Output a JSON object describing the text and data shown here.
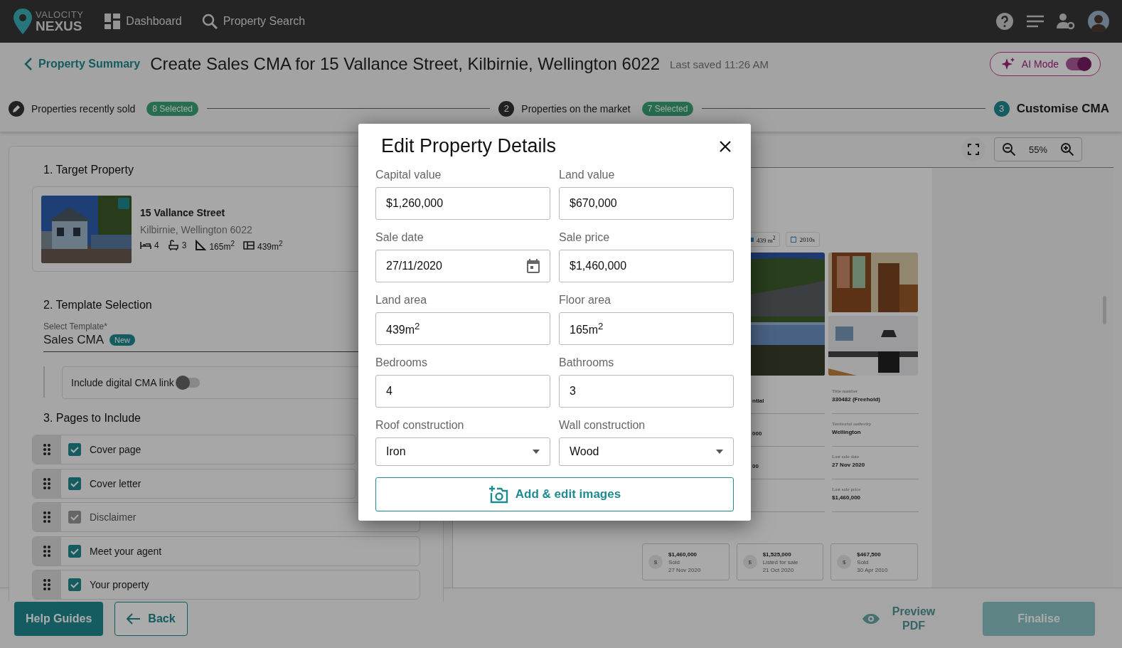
{
  "topbar": {
    "brand_top": "VALOCITY",
    "brand_bottom": "NEXUS",
    "nav": [
      {
        "kind": "dashboard",
        "label": "Dashboard"
      },
      {
        "kind": "search",
        "label": "Property Search"
      }
    ]
  },
  "header": {
    "back_link": "Property Summary",
    "title": "Create Sales CMA for 15 Vallance Street, Kilbirnie, Wellington 6022",
    "last_saved": "Last saved 11:26 AM",
    "ai_mode": {
      "label": "AI Mode",
      "on": true
    }
  },
  "stepper": [
    {
      "kind": "edit",
      "label": "Properties recently sold",
      "badge": "8 Selected",
      "selected": false
    },
    {
      "kind": "number",
      "number": "2",
      "label": "Properties on the market",
      "badge": "7 Selected",
      "selected": false
    },
    {
      "kind": "number",
      "number": "3",
      "label": "Customise CMA",
      "selected": true
    }
  ],
  "target_property": {
    "heading": "1. Target Property",
    "name": "15 Vallance Street",
    "address": "Kilbirnie, Wellington 6022",
    "stats": [
      {
        "kind": "bed",
        "value": "4"
      },
      {
        "kind": "bath",
        "value": "3"
      },
      {
        "kind": "floor",
        "value": "165m$^{2}$"
      },
      {
        "kind": "land",
        "value": "439m$^{2}$"
      }
    ]
  },
  "template": {
    "heading": "2. Template Selection",
    "label": "Select Template*",
    "value": "Sales CMA",
    "badge": "New",
    "digital_link": {
      "label": "Include digital CMA link",
      "on": false
    }
  },
  "pages": {
    "heading": "3. Pages to Include",
    "items": [
      {
        "label": "Cover page",
        "checked": true,
        "disabled": false
      },
      {
        "label": "Cover letter",
        "checked": true,
        "disabled": false
      },
      {
        "label": "Disclaimer",
        "checked": true,
        "disabled": true
      },
      {
        "label": "Meet your agent",
        "checked": true,
        "disabled": false
      },
      {
        "label": "Your property",
        "checked": true,
        "disabled": false
      }
    ]
  },
  "preview": {
    "zoom": "55%",
    "chips": [
      {
        "kind": "area",
        "label": "439 m$^{2}$"
      },
      {
        "kind": "year",
        "label": "2010s"
      }
    ],
    "left_values": [
      "ntial",
      "000",
      "00"
    ],
    "details": [
      {
        "label": "Title number",
        "value": "330482 (Freehold)"
      },
      {
        "label": "Territorial authority",
        "value": "Wellington"
      },
      {
        "label": "Last sale date",
        "value": "27 Nov 2020"
      },
      {
        "label": "Last sale price",
        "value": "$1,460,000"
      }
    ],
    "sales": [
      {
        "icon": "$",
        "price": "$1,460,000",
        "status": "Sold",
        "date": "27 Nov 2020"
      },
      {
        "icon": "$",
        "price": "$1,525,000",
        "status": "Listed for sale",
        "date": "21 Oct 2020"
      },
      {
        "icon": "$",
        "price": "$467,500",
        "status": "Sold",
        "date": "30 Apr 2010"
      }
    ]
  },
  "modal": {
    "title": "Edit Property Details",
    "fields": [
      {
        "kind": "text",
        "label": "Capital value",
        "value": "$1,260,000"
      },
      {
        "kind": "text",
        "label": "Land value",
        "value": "$670,000"
      },
      {
        "kind": "date",
        "label": "Sale date",
        "value": "27/11/2020"
      },
      {
        "kind": "text",
        "label": "Sale price",
        "value": "$1,460,000"
      },
      {
        "kind": "text",
        "label": "Land area",
        "value": "439m$^{2}$"
      },
      {
        "kind": "text",
        "label": "Floor area",
        "value": "165m$^{2}$"
      },
      {
        "kind": "text",
        "label": "Bedrooms",
        "value": "4"
      },
      {
        "kind": "text",
        "label": "Bathrooms",
        "value": "3"
      },
      {
        "kind": "select",
        "label": "Roof construction",
        "value": "Iron"
      },
      {
        "kind": "select",
        "label": "Wall construction",
        "value": "Wood"
      }
    ],
    "images_button": "Add & edit images"
  },
  "footer": {
    "help": "Help Guides",
    "back": "Back",
    "preview_pdf": "Preview PDF",
    "finalise": "Finalise",
    "finalise_disabled": true
  }
}
